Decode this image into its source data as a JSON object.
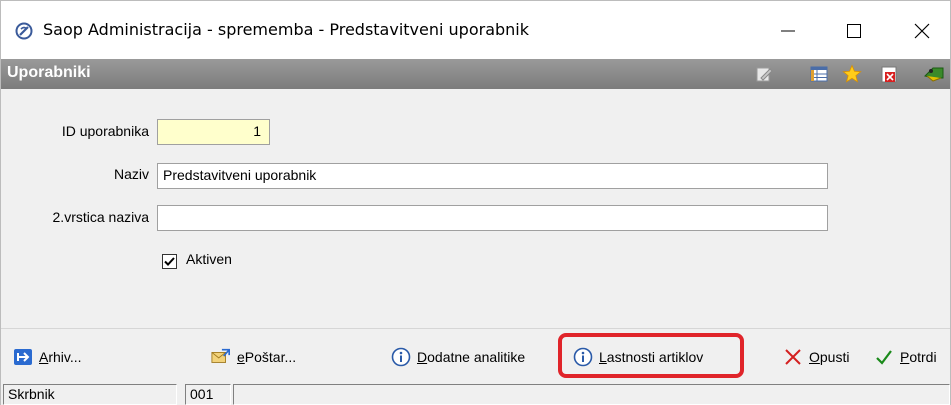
{
  "window": {
    "title": "Saop Administracija - sprememba - Predstavitveni uporabnik",
    "minimize_glyph": "—",
    "maximize_glyph": "☐",
    "close_glyph": "✕"
  },
  "section": {
    "title": "Uporabniki",
    "icons": [
      "edit-icon",
      "table-icon",
      "favorite-star-icon",
      "delete-icon",
      "exit-icon"
    ]
  },
  "form": {
    "id_label": "ID uporabnika",
    "id_value": "1",
    "name_label": "Naziv",
    "name_value": "Predstavitveni uporabnik",
    "name2_label": "2.vrstica naziva",
    "name2_value": "",
    "active_label": "Aktiven",
    "active_checked": true
  },
  "toolbar": {
    "archive_prefix": "A",
    "archive_rest": "rhiv...",
    "email_prefix": "e",
    "email_rest": "Poštar...",
    "analytics_prefix": "D",
    "analytics_rest": "odatne analitike",
    "article_props_prefix": "L",
    "article_props_rest": "astnosti artiklov",
    "cancel_prefix": "O",
    "cancel_rest": "pusti",
    "confirm_prefix": "P",
    "confirm_rest": "otrdi",
    "highlight_color": "#e0242a"
  },
  "status": {
    "user": "Skrbnik",
    "code": "001"
  }
}
